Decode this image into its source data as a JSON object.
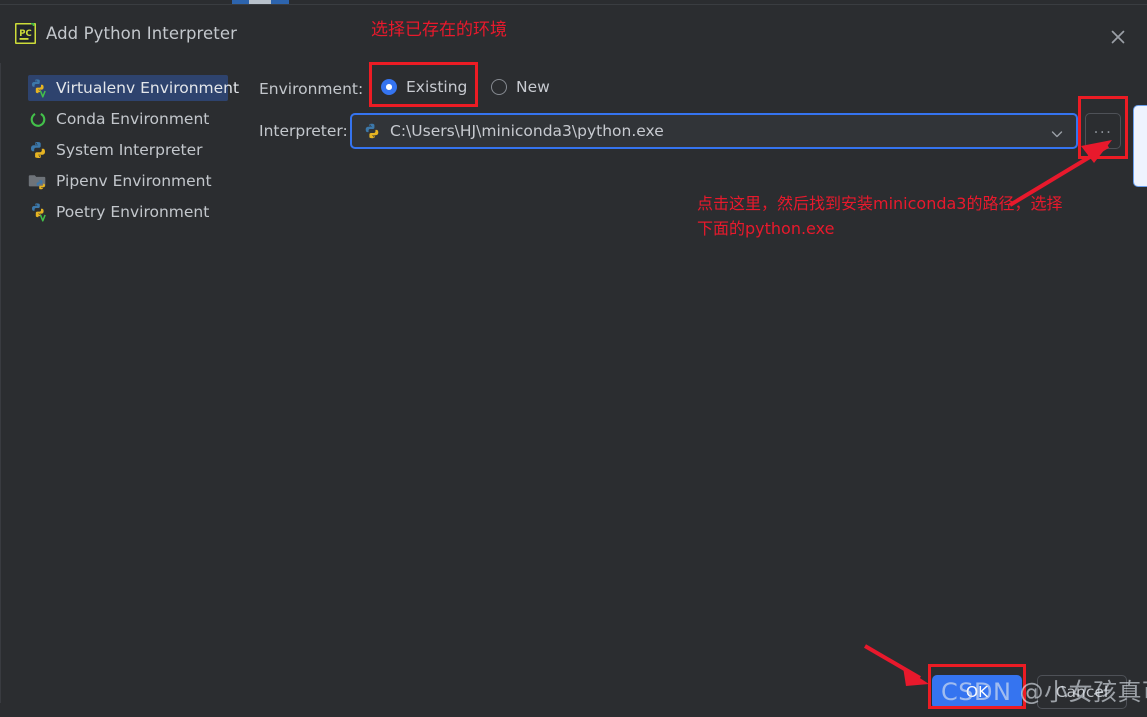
{
  "window": {
    "title": "Add Python Interpreter",
    "app_icon": "pycharm-icon",
    "close_icon": "close-icon"
  },
  "sidebar": {
    "items": [
      {
        "label": "Virtualenv Environment",
        "icon": "python-venv-icon",
        "selected": true
      },
      {
        "label": "Conda Environment",
        "icon": "conda-icon",
        "selected": false
      },
      {
        "label": "System Interpreter",
        "icon": "python-icon",
        "selected": false
      },
      {
        "label": "Pipenv Environment",
        "icon": "pipenv-folder-icon",
        "selected": false
      },
      {
        "label": "Poetry Environment",
        "icon": "poetry-icon",
        "selected": false
      }
    ]
  },
  "form": {
    "environment_label": "Environment:",
    "radios": [
      {
        "label": "Existing",
        "selected": true
      },
      {
        "label": "New",
        "selected": false
      }
    ],
    "interpreter_label": "Interpreter:",
    "interpreter_value": "C:\\Users\\HJ\\miniconda3\\python.exe",
    "interpreter_icon": "python-icon",
    "dropdown_icon": "chevron-down-icon",
    "browse_button_label": "...",
    "browse_button_icon": "ellipsis-icon"
  },
  "footer": {
    "ok_label": "OK",
    "cancel_label": "Cancel"
  },
  "annotations": {
    "title_note": "选择已存在的环境",
    "browse_note_line1": "点击这里，然后找到安装miniconda3的路径，选择",
    "browse_note_line2": "下面的python.exe",
    "highlight_color": "#ec1c24",
    "arrow_color": "#e8192c"
  },
  "watermark": {
    "text": "CSDN @小女孩真可爱"
  },
  "colors": {
    "background": "#2b2d30",
    "selection": "#2e436e",
    "accent": "#3574f0",
    "text": "#c3c7cc",
    "annotation_red": "#ec1c24"
  }
}
